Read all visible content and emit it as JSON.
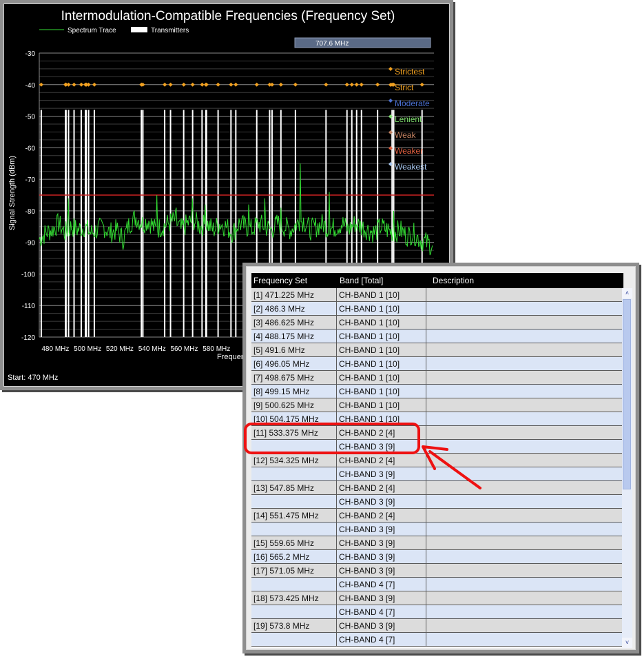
{
  "chart": {
    "title": "Intermodulation-Compatible Frequencies (Frequency Set)",
    "legend_spectrum": "Spectrum Trace",
    "legend_transmitters": "Transmitters",
    "readout": "707.6 MHz",
    "ylabel": "Signal Strength (dBm)",
    "xlabel_partial": "Frequen",
    "start_label": "Start: 470 MHz",
    "y_ticks": [
      "-30",
      "-40",
      "-50",
      "-60",
      "-70",
      "-80",
      "-90",
      "-100",
      "-110",
      "-120"
    ],
    "x_ticks": [
      "480 MHz",
      "500 MHz",
      "520 MHz",
      "540 MHz",
      "560 MHz",
      "580 MHz"
    ],
    "side_legend": [
      {
        "label": "Strictest",
        "color": "#f0a020"
      },
      {
        "label": "Strict",
        "color": "#f0a020"
      },
      {
        "label": "Moderate",
        "color": "#4a6fd0"
      },
      {
        "label": "Lenient",
        "color": "#80e070"
      },
      {
        "label": "Weak",
        "color": "#c08060"
      },
      {
        "label": "Weaker",
        "color": "#e06040"
      },
      {
        "label": "Weakest",
        "color": "#a8c8f0"
      }
    ],
    "colors": {
      "trace": "#33dd33",
      "transmitter": "#ffffff",
      "threshold": "#cc2222",
      "marker": "#f0a020",
      "readout_box": "#5a6a86"
    }
  },
  "chart_data": {
    "type": "line",
    "title": "Intermodulation-Compatible Frequencies (Frequency Set)",
    "xlabel": "Frequen",
    "ylabel": "Signal Strength (dBm)",
    "ylim": [
      -120,
      -30
    ],
    "xlim": [
      470,
      715
    ],
    "grid": true,
    "legend_placement": "top-left",
    "series": [
      {
        "name": "Spectrum Trace",
        "x": [
          470,
          474,
          478,
          482,
          486,
          490,
          494,
          498,
          502,
          506,
          510,
          514,
          518,
          522,
          526,
          530,
          534,
          538,
          542,
          546,
          550,
          554,
          558,
          562,
          566,
          570,
          574,
          578,
          582,
          586,
          590,
          594,
          598,
          602,
          606,
          610,
          614,
          618,
          622,
          626,
          630,
          634,
          638,
          642,
          646,
          650,
          654,
          658,
          662,
          666,
          670,
          674,
          678,
          682,
          686,
          690,
          694,
          698,
          702,
          706,
          710,
          714
        ],
        "y": [
          -89,
          -87,
          -86,
          -84,
          -87,
          -85,
          -86,
          -85,
          -87,
          -86,
          -85,
          -87,
          -86,
          -89,
          -84,
          -82,
          -84,
          -83,
          -86,
          -85,
          -84,
          -83,
          -86,
          -84,
          -83,
          -85,
          -84,
          -86,
          -84,
          -85,
          -87,
          -84,
          -85,
          -86,
          -84,
          -85,
          -86,
          -84,
          -85,
          -86,
          -84,
          -83,
          -86,
          -85,
          -84,
          -86,
          -85,
          -84,
          -86,
          -84,
          -85,
          -86,
          -87,
          -85,
          -86,
          -87,
          -86,
          -88,
          -87,
          -89,
          -90,
          -91
        ]
      },
      {
        "name": "Transmitters",
        "x": [
          471.225,
          486.3,
          486.625,
          488.175,
          491.6,
          496.05,
          498.675,
          499.15,
          500.625,
          504.175,
          533.375,
          534.325,
          547.85,
          551.475,
          559.65,
          565.2,
          571.05,
          573.425,
          573.8
        ]
      }
    ],
    "threshold_dbm": -75,
    "marker_level_dbm": -40,
    "marker_x": [
      471.2,
      486.3,
      486.6,
      488.2,
      491.6,
      496.1,
      498.7,
      499.2,
      500.6,
      504.2,
      533.4,
      534.3,
      547.9,
      551.5,
      559.7,
      565.2,
      571.1,
      573.4,
      573.8,
      581.0,
      589.0,
      592.0,
      605.0,
      613.0,
      614.5,
      620.0,
      629.0,
      648.0,
      661.0,
      664.0,
      667.0,
      670.0,
      680.0,
      689.0,
      690.0,
      707.6
    ]
  },
  "table": {
    "headers": [
      "Frequency Set",
      "Band [Total]",
      "Description"
    ],
    "scroll_up": "˄",
    "scroll_down": "˅",
    "rows": [
      {
        "freq": "[1] 471.225 MHz",
        "band": "CH-BAND 1 [10]"
      },
      {
        "freq": "[2] 486.3 MHz",
        "band": "CH-BAND 1 [10]"
      },
      {
        "freq": "[3] 486.625 MHz",
        "band": "CH-BAND 1 [10]"
      },
      {
        "freq": "[4] 488.175 MHz",
        "band": "CH-BAND 1 [10]"
      },
      {
        "freq": "[5] 491.6 MHz",
        "band": "CH-BAND 1 [10]"
      },
      {
        "freq": "[6] 496.05 MHz",
        "band": "CH-BAND 1 [10]"
      },
      {
        "freq": "[7] 498.675 MHz",
        "band": "CH-BAND 1 [10]"
      },
      {
        "freq": "[8] 499.15 MHz",
        "band": "CH-BAND 1 [10]"
      },
      {
        "freq": "[9] 500.625 MHz",
        "band": "CH-BAND 1 [10]"
      },
      {
        "freq": "[10] 504.175 MHz",
        "band": "CH-BAND 1 [10]"
      },
      {
        "freq": "[11] 533.375 MHz",
        "band": "CH-BAND 2 [4]"
      },
      {
        "freq": "",
        "band": "CH-BAND 3 [9]"
      },
      {
        "freq": "[12] 534.325 MHz",
        "band": "CH-BAND 2 [4]"
      },
      {
        "freq": "",
        "band": "CH-BAND 3 [9]"
      },
      {
        "freq": "[13] 547.85 MHz",
        "band": "CH-BAND 2 [4]"
      },
      {
        "freq": "",
        "band": "CH-BAND 3 [9]"
      },
      {
        "freq": "[14] 551.475 MHz",
        "band": "CH-BAND 2 [4]"
      },
      {
        "freq": "",
        "band": "CH-BAND 3 [9]"
      },
      {
        "freq": "[15] 559.65 MHz",
        "band": "CH-BAND 3 [9]"
      },
      {
        "freq": "[16] 565.2 MHz",
        "band": "CH-BAND 3 [9]"
      },
      {
        "freq": "[17] 571.05 MHz",
        "band": "CH-BAND 3 [9]"
      },
      {
        "freq": "",
        "band": "CH-BAND 4 [7]"
      },
      {
        "freq": "[18] 573.425 MHz",
        "band": "CH-BAND 3 [9]"
      },
      {
        "freq": "",
        "band": "CH-BAND 4 [7]"
      },
      {
        "freq": "[19] 573.8 MHz",
        "band": "CH-BAND 3 [9]"
      },
      {
        "freq": "",
        "band": "CH-BAND 4 [7]"
      }
    ]
  },
  "annotation": {
    "color": "#ee1111"
  }
}
